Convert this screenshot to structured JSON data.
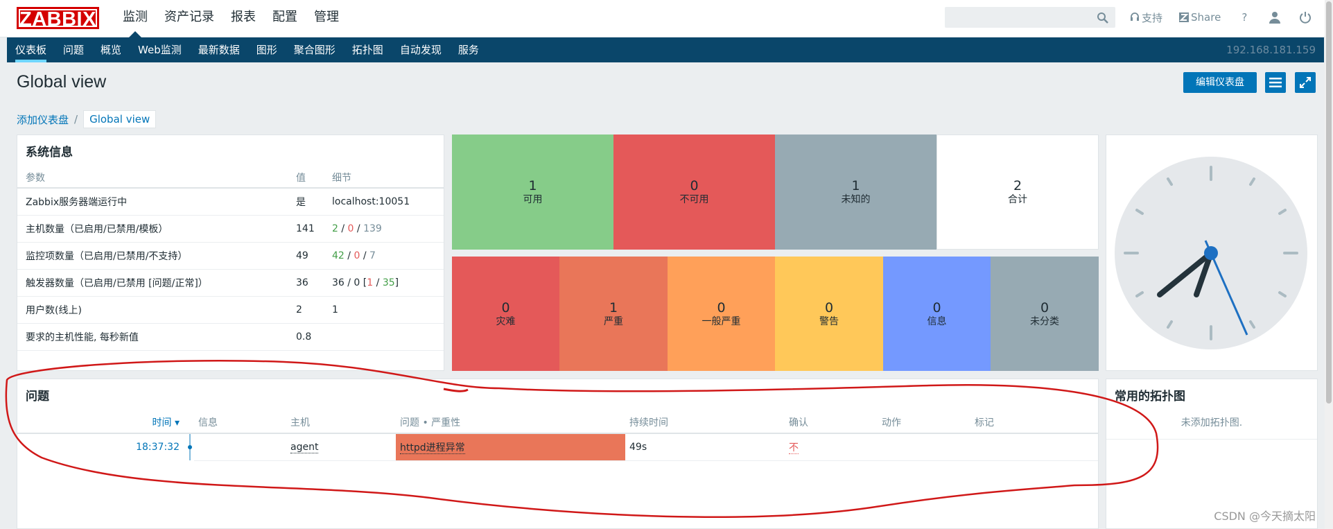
{
  "header": {
    "logo": "ZABBIX",
    "menu": [
      "监测",
      "资产记录",
      "报表",
      "配置",
      "管理"
    ],
    "search_placeholder": "",
    "support_label": "支持",
    "share_label": "Share",
    "help_label": "?"
  },
  "subnav": {
    "items": [
      "仪表板",
      "问题",
      "概览",
      "Web监测",
      "最新数据",
      "图形",
      "聚合图形",
      "拓扑图",
      "自动发现",
      "服务"
    ],
    "ip": "192.168.181.159"
  },
  "page": {
    "title": "Global view",
    "edit_button": "编辑仪表盘",
    "breadcrumb": [
      "添加仪表盘",
      "Global view"
    ],
    "breadcrumb_sep": "/"
  },
  "sysinfo": {
    "title": "系统信息",
    "headers": [
      "参数",
      "值",
      "细节"
    ],
    "rows": [
      {
        "param": "Zabbix服务器端运行中",
        "value": "是",
        "detail": "localhost:10051"
      },
      {
        "param": "主机数量（已启用/已禁用/模板）",
        "value": "141",
        "d1": "2",
        "d2": "0",
        "d3": "139",
        "s": " / "
      },
      {
        "param": "监控项数量（已启用/已禁用/不支持）",
        "value": "49",
        "d1": "42",
        "d2": "0",
        "d3": "7",
        "s": " / "
      },
      {
        "param": "触发器数量（已启用/已禁用 [问题/正常]）",
        "value": "36",
        "prefix": "36 / 0 [",
        "d1": "1",
        "mid": " / ",
        "d2": "35",
        "suffix": "]"
      },
      {
        "param": "用户数(线上)",
        "value": "2",
        "detail": "1"
      },
      {
        "param": "要求的主机性能, 每秒新值",
        "value": "0.8",
        "detail": ""
      }
    ]
  },
  "host_availability": [
    {
      "count": "1",
      "label": "可用",
      "color": "#86cc89"
    },
    {
      "count": "0",
      "label": "不可用",
      "color": "#e45959"
    },
    {
      "count": "1",
      "label": "未知的",
      "color": "#97aab3"
    },
    {
      "count": "2",
      "label": "合计",
      "color": "#ffffff"
    }
  ],
  "problems_by_severity": [
    {
      "count": "0",
      "label": "灾难",
      "color": "#e45959"
    },
    {
      "count": "1",
      "label": "严重",
      "color": "#e97659"
    },
    {
      "count": "0",
      "label": "一般严重",
      "color": "#ffa059"
    },
    {
      "count": "0",
      "label": "警告",
      "color": "#ffc859"
    },
    {
      "count": "0",
      "label": "信息",
      "color": "#7499ff"
    },
    {
      "count": "0",
      "label": "未分类",
      "color": "#97aab3"
    }
  ],
  "problems": {
    "title": "问题",
    "headers": [
      "时间 ▾",
      "信息",
      "主机",
      "问题 • 严重性",
      "持续时间",
      "确认",
      "动作",
      "标记"
    ],
    "rows": [
      {
        "time": "18:37:32",
        "info": "",
        "host": "agent",
        "problem": "httpd进程异常",
        "severity_color": "#e97659",
        "duration": "49s",
        "ack": "不",
        "actions": "",
        "tags": ""
      }
    ]
  },
  "favorite_maps": {
    "title": "常用的拓扑图",
    "empty": "未添加拓扑图."
  },
  "watermark": "CSDN @今天摘太阳"
}
